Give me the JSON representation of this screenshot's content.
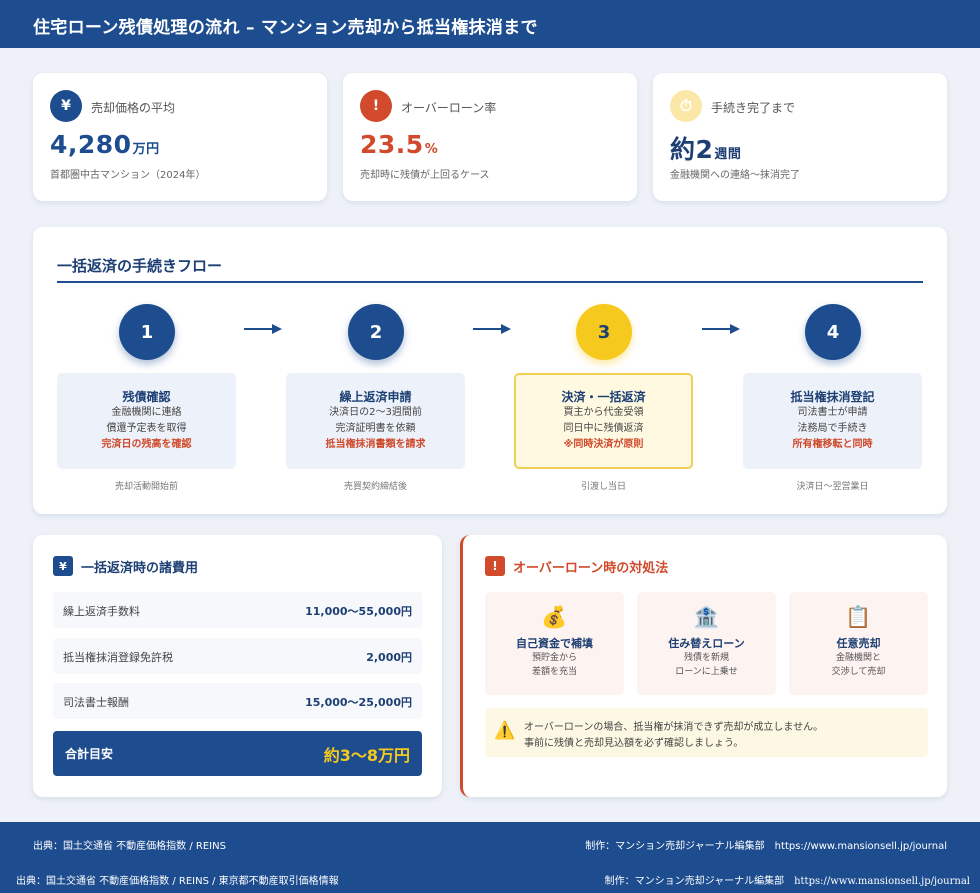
{
  "header": {
    "title": "住宅ローン残債処理の流れ – マンション売却から抵当権抹消まで"
  },
  "stats": [
    {
      "icon": "yen-icon",
      "symbol": "¥",
      "label": "売却価格の平均",
      "value": "4,280",
      "unit": "万円",
      "note": "首都圏中古マンション（2024年）",
      "color": "#1d4c8f"
    },
    {
      "icon": "exclamation-icon",
      "symbol": "!",
      "label": "オーバーローン率",
      "value": "23.5",
      "unit": "%",
      "note": "売却時に残債が上回るケース",
      "color": "#d04a2b"
    },
    {
      "icon": "stopwatch-icon",
      "symbol": "⏱",
      "label": "手続き完了まで",
      "value_prefix": "約",
      "value": "2",
      "unit": "週間",
      "note": "金融機関への連絡〜抹消完了",
      "color": "#1d3f73"
    }
  ],
  "flow": {
    "title": "一括返済の手続きフロー",
    "steps": [
      {
        "num": "1",
        "title": "残債確認",
        "lines": [
          "金融機関に連絡",
          "償還予定表を取得"
        ],
        "highlight": "完済日の残高を確認",
        "timing": "売却活動開始前"
      },
      {
        "num": "2",
        "title": "繰上返済申請",
        "lines": [
          "決済日の2〜3週間前",
          "完済証明書を依頼"
        ],
        "highlight": "抵当権抹消書類を請求",
        "timing": "売買契約締結後"
      },
      {
        "num": "3",
        "title": "決済・一括返済",
        "lines": [
          "買主から代金受領",
          "同日中に残債返済"
        ],
        "highlight": "※同時決済が原則",
        "timing": "引渡し当日"
      },
      {
        "num": "4",
        "title": "抵当権抹消登記",
        "lines": [
          "司法書士が申請",
          "法務局で手続き"
        ],
        "highlight": "所有権移転と同時",
        "timing": "決済日〜翌営業日"
      }
    ]
  },
  "fees": {
    "icon_symbol": "¥",
    "title": "一括返済時の諸費用",
    "rows": [
      {
        "label": "繰上返済手数料",
        "value": "11,000〜55,000円"
      },
      {
        "label": "抵当権抹消登録免許税",
        "value": "2,000円"
      },
      {
        "label": "司法書士報酬",
        "value": "15,000〜25,000円"
      }
    ],
    "total_label": "合計目安",
    "total_value": "約3〜8万円"
  },
  "overloan": {
    "icon_symbol": "!",
    "title": "オーバーローン時の対処法",
    "options": [
      {
        "icon": "money-bag-icon",
        "emoji": "💰",
        "title": "自己資金で補填",
        "lines": [
          "預貯金から",
          "差額を充当"
        ]
      },
      {
        "icon": "bank-icon",
        "emoji": "🏦",
        "title": "住み替えローン",
        "lines": [
          "残債を新規",
          "ローンに上乗せ"
        ]
      },
      {
        "icon": "clipboard-icon",
        "emoji": "📋",
        "title": "任意売却",
        "lines": [
          "金融機関と",
          "交渉して売却"
        ]
      }
    ],
    "note_icon": "⚠️",
    "note_lines": [
      "オーバーローンの場合、抵当権が抹消できず売却が成立しません。",
      "事前に残債と売却見込額を必ず確認しましょう。"
    ]
  },
  "footer": {
    "source": "出典：国土交通省 不動産価格指数 / REINS",
    "credit": "制作：マンション売却ジャーナル編集部　https://www.mansionsell.jp/journal"
  },
  "footer2": {
    "source": "出典：国土交通省 不動産価格指数 / REINS / 東京都不動産取引価格情報",
    "credit_label": "制作：マンション売却ジャーナル編集部",
    "url": "https://www.mansionsell.jp/journal"
  }
}
